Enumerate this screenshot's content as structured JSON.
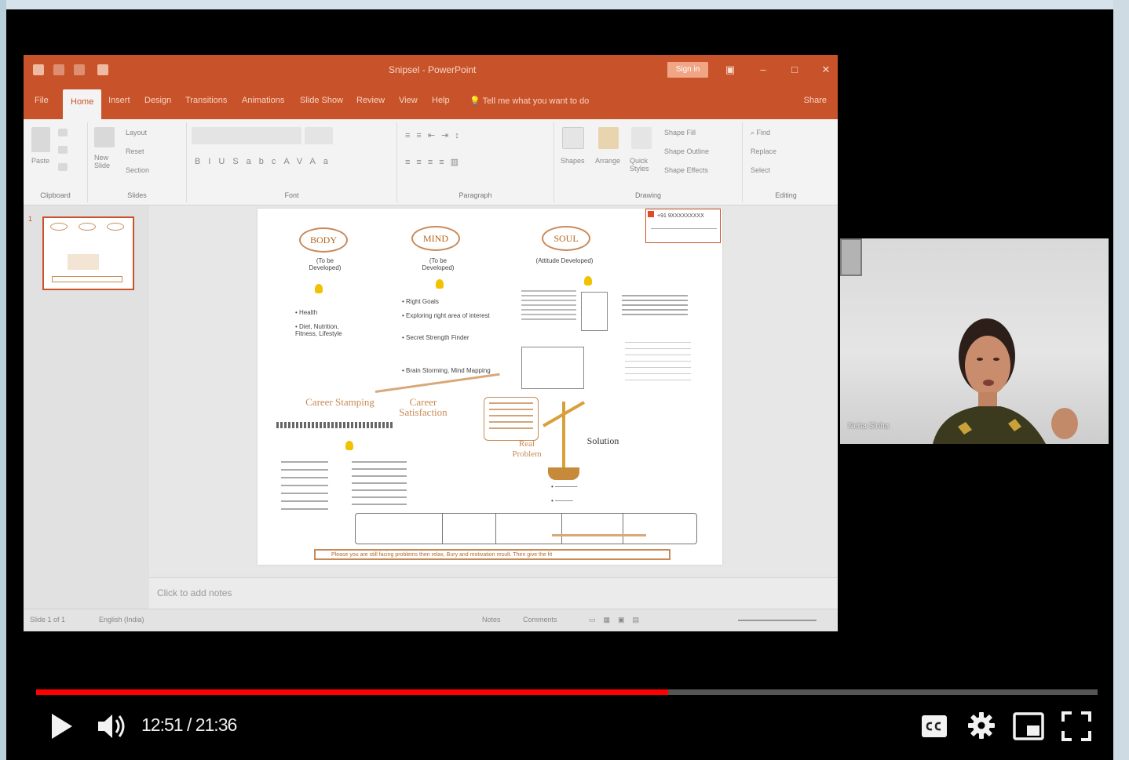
{
  "powerpoint": {
    "title": "Snipsel - PowerPoint",
    "sign_in": "Sign in",
    "tabs": [
      "File",
      "Home",
      "Insert",
      "Design",
      "Transitions",
      "Animations",
      "Slide Show",
      "Review",
      "View",
      "Help"
    ],
    "tell_me": "Tell me what you want to do",
    "share": "Share",
    "ribbon_groups": [
      "Clipboard",
      "Slides",
      "Font",
      "Paragraph",
      "Drawing",
      "Editing"
    ],
    "ribbon_buttons": {
      "paste": "Paste",
      "new_slide": "New Slide",
      "layout": "Layout",
      "reset": "Reset",
      "section": "Section",
      "shapes": "Shapes",
      "arrange": "Arrange",
      "quick_styles": "Quick Styles",
      "shape_fill": "Shape Fill",
      "shape_outline": "Shape Outline",
      "shape_effects": "Shape Effects",
      "find": "Find",
      "replace": "Replace",
      "select": "Select"
    },
    "notes_placeholder": "Click to add notes",
    "status": {
      "slide": "Slide 1 of 1",
      "language": "English (India)",
      "notes": "Notes",
      "comments": "Comments"
    },
    "slide": {
      "body": "BODY",
      "mind": "MIND",
      "soul": "SOUL",
      "body_sub": "(To be Developed)",
      "mind_sub": "(To be Developed)",
      "soul_sub": "(Attitude Developed)",
      "body_points": [
        "Health",
        "Diet, Nutrition, Fitness, Lifestyle"
      ],
      "mind_points": [
        "Right Goals",
        "Exploring right area of interest",
        "Secret Strength Finder",
        "Brain Storming, Mind Mapping"
      ],
      "career_stamping": "Career Stamping",
      "career_satisfaction": "Career Satisfaction",
      "problem": "Real Problem",
      "solution": "Solution",
      "phone": "+91 9XXXXXXXXX",
      "footer": "Please you are still facing problems then relax, Bury and motivation result. Then give the fit"
    }
  },
  "webcam": {
    "name": "Neha Sinha"
  },
  "player": {
    "time": "12:51 / 21:36",
    "progress": 0.5953
  },
  "colors": {
    "ppt_orange": "#c8532a",
    "progress_red": "#ff0000"
  }
}
